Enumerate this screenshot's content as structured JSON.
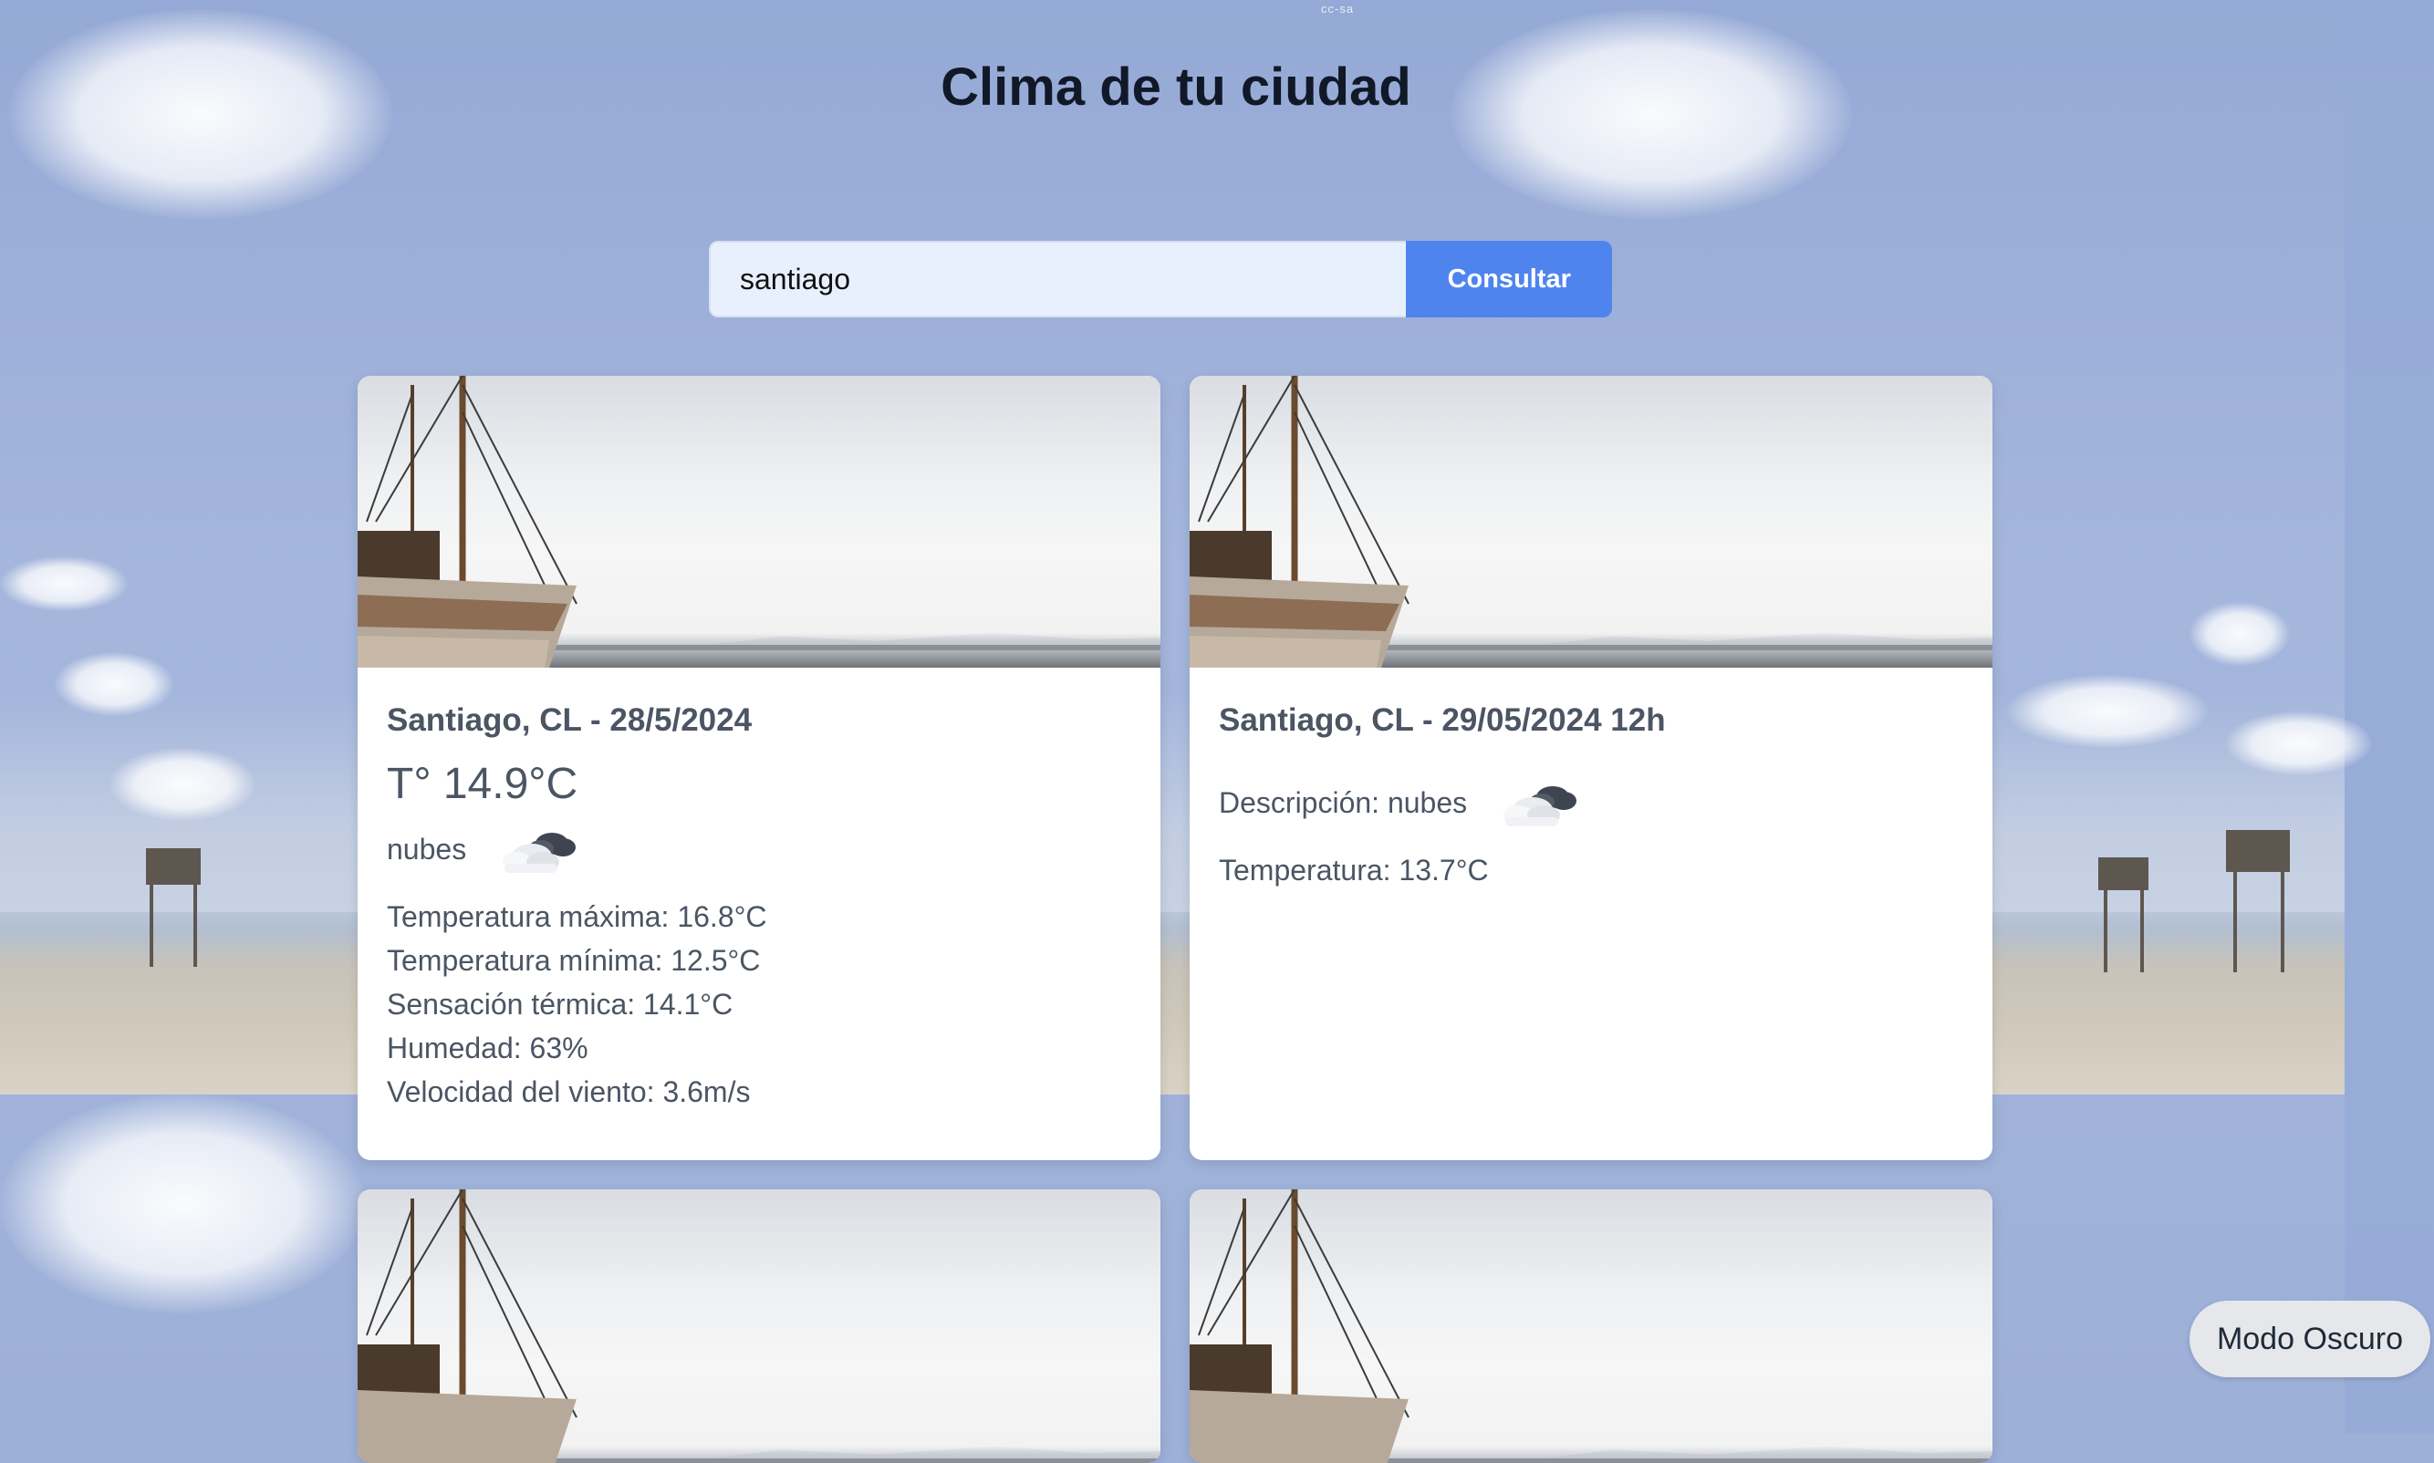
{
  "page": {
    "credit": "cc-sa",
    "title": "Clima de tu ciudad"
  },
  "search": {
    "value": "santiago",
    "button_label": "Consultar"
  },
  "current": {
    "heading": "Santiago, CL - 28/5/2024",
    "temperature": "T° 14.9°C",
    "description": "nubes",
    "icon": "cloud-icon",
    "details": [
      "Temperatura máxima: 16.8°C",
      "Temperatura mínima: 12.5°C",
      "Sensación térmica: 14.1°C",
      "Humedad: 63%",
      "Velocidad del viento: 3.6m/s"
    ]
  },
  "forecast": {
    "heading": "Santiago, CL - 29/05/2024 12h",
    "description": "Descripción: nubes",
    "icon": "cloud-icon",
    "temperature": "Temperatura: 13.7°C"
  },
  "theme_toggle": {
    "label": "Modo Oscuro"
  },
  "colors": {
    "accent": "#4f84ef",
    "title": "#111827",
    "card_text": "#4b5563",
    "background": "#9cb0d8"
  }
}
